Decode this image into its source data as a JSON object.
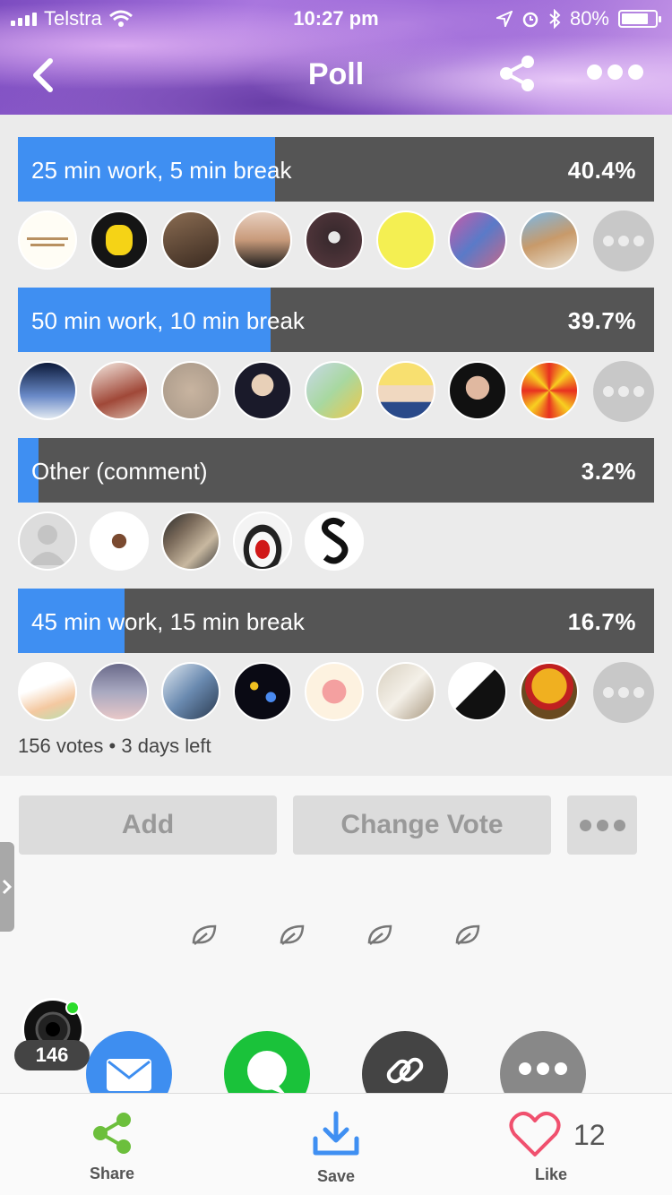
{
  "status": {
    "carrier": "Telstra",
    "time": "10:27 pm",
    "battery_pct": "80%",
    "battery_level": 0.8
  },
  "nav": {
    "title": "Poll"
  },
  "poll": {
    "options": [
      {
        "label": "25 min work, 5 min break",
        "percent": "40.4%",
        "fraction": 0.404,
        "voters": [
          "avatar-1",
          "avatar-2",
          "avatar-3",
          "avatar-4",
          "avatar-5",
          "avatar-6",
          "avatar-7",
          "avatar-8"
        ],
        "has_more": true
      },
      {
        "label": "50 min work, 10 min break",
        "percent": "39.7%",
        "fraction": 0.397,
        "voters": [
          "avatar-1",
          "avatar-2",
          "avatar-3",
          "avatar-4",
          "avatar-5",
          "avatar-6",
          "avatar-7",
          "avatar-8"
        ],
        "has_more": true
      },
      {
        "label": "Other (comment)",
        "percent": "3.2%",
        "fraction": 0.032,
        "voters": [
          "avatar-1",
          "avatar-2",
          "avatar-3",
          "avatar-4",
          "avatar-5"
        ],
        "has_more": false
      },
      {
        "label": "45 min work, 15 min break",
        "percent": "16.7%",
        "fraction": 0.167,
        "voters": [
          "avatar-1",
          "avatar-2",
          "avatar-3",
          "avatar-4",
          "avatar-5",
          "avatar-6",
          "avatar-7",
          "avatar-8"
        ],
        "has_more": true
      }
    ],
    "votes_text": "156 votes",
    "time_left_text": "3 days left"
  },
  "actions": {
    "add_label": "Add",
    "change_vote_label": "Change Vote"
  },
  "viewers": {
    "count": "146"
  },
  "toolbar": {
    "share_label": "Share",
    "save_label": "Save",
    "like_label": "Like",
    "like_count": "12"
  },
  "colors": {
    "fill": "#3f8ff2",
    "bar_bg": "#555555",
    "share_green": "#6cbf3c",
    "save_blue": "#3f8ff2",
    "like_red": "#f0506e"
  }
}
